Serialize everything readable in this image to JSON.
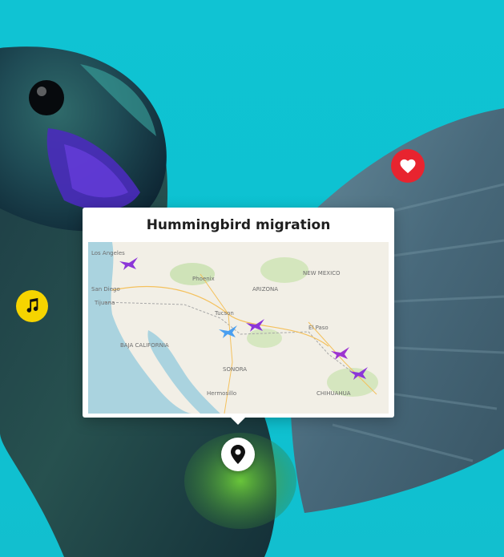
{
  "card": {
    "title": "Hummingbird migration"
  },
  "map": {
    "labels": {
      "la": "Los Angeles",
      "phoenix": "Phoenix",
      "san_diego": "San Diego",
      "tijuana": "Tijuana",
      "tucson": "Tucson",
      "el_paso": "El Paso",
      "hermosillo": "Hermosillo",
      "new_mexico": "NEW MEXICO",
      "sonora": "SONORA",
      "chihuahua": "CHIHUAHUA",
      "baja": "BAJA CALIFORNIA",
      "arizona": "ARIZONA"
    },
    "bird_colors": [
      "#8c36d8",
      "#4a9ff0",
      "#8c36d8",
      "#9d34d0",
      "#8c36d8"
    ]
  },
  "icons": {
    "music": "music-note-icon",
    "heart": "heart-icon",
    "pin": "map-pin-icon"
  },
  "colors": {
    "background": "#10c3d3",
    "music_badge": "#f6d400",
    "heart_badge": "#e8242f"
  }
}
